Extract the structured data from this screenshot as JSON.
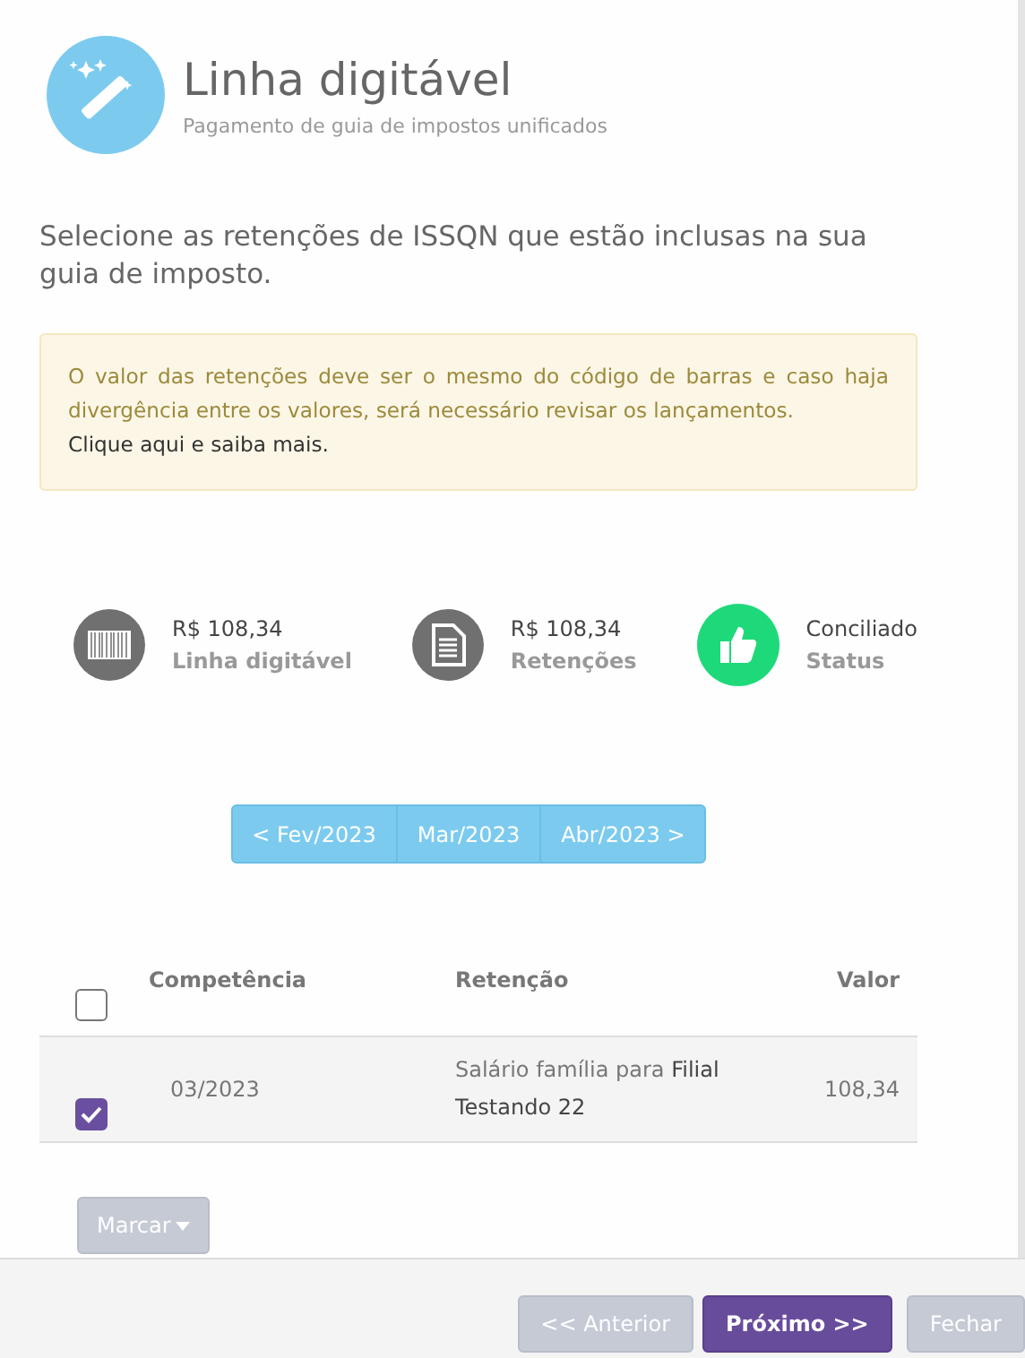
{
  "header": {
    "title": "Linha digitável",
    "subtitle": "Pagamento de guia de impostos unificados"
  },
  "instruction": "Selecione as retenções de ISSQN que estão inclusas na sua guia de imposto.",
  "alert": {
    "message": "O valor das retenções deve ser o mesmo do código de barras e caso haja divergência entre os valores, será necessário revisar os lançamentos.",
    "link": "Clique aqui e saiba mais."
  },
  "summary": [
    {
      "kind": "barcode",
      "color": "#707070",
      "value": "R$ 108,34",
      "label": "Linha digitável"
    },
    {
      "kind": "document",
      "color": "#707070",
      "value": "R$ 108,34",
      "label": "Retenções"
    },
    {
      "kind": "thumb",
      "color": "#1ed97a",
      "value": "Conciliado",
      "label": "Status"
    }
  ],
  "pager": [
    {
      "label": "< Fev/2023"
    },
    {
      "label": "Mar/2023"
    },
    {
      "label": "Abr/2023 >"
    }
  ],
  "table": {
    "select_all_checked": false,
    "columns": [
      "Competência",
      "Retenção",
      "Valor"
    ],
    "rows": [
      {
        "checked": true,
        "competencia": "03/2023",
        "retencao": {
          "text": "Salário família para",
          "entity": "Filial Testando 22"
        },
        "valor": "108,34"
      }
    ]
  },
  "mark_button": "Marcar",
  "footer_buttons": [
    {
      "kind": "secondary",
      "label": "<< Anterior"
    },
    {
      "kind": "primary",
      "label": "Próximo >>"
    },
    {
      "kind": "secondary",
      "label": "Fechar"
    }
  ]
}
